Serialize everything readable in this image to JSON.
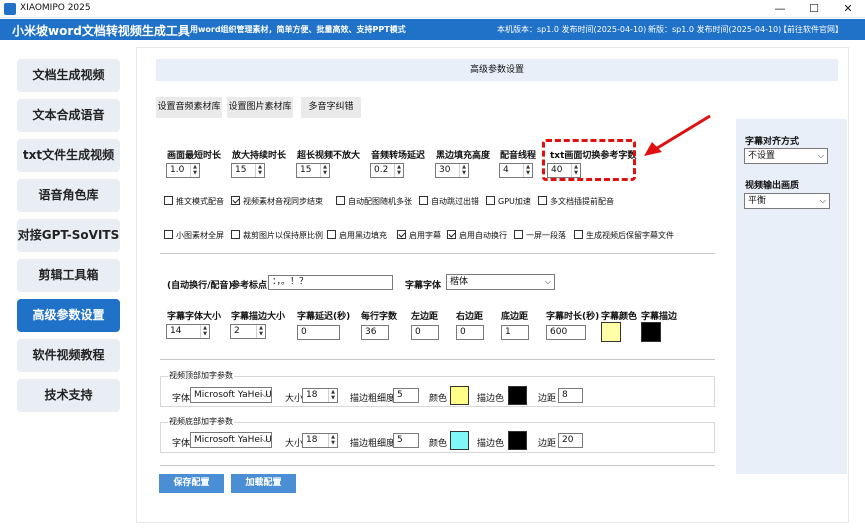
{
  "window": {
    "title": "XIAOMIPO 2025",
    "minimize": "—",
    "maximize": "☐",
    "close": "✕"
  },
  "header": {
    "brand": "小米坡word文档转视频生成工具",
    "slogan": "用word组织管理素材，简单方便、批量高效、支持PPT模式",
    "local_version": "本机版本：sp1.0  发布时间(2025-04-10)",
    "new_version": "新版：sp1.0  发布时间(2025-04-10)",
    "website_link": "【前往软件官网】"
  },
  "sidebar": {
    "items": [
      {
        "label": "文档生成视频"
      },
      {
        "label": "文本合成语音"
      },
      {
        "label": "txt文件生成视频"
      },
      {
        "label": "语音角色库"
      },
      {
        "label": "对接GPT-SoVITS"
      },
      {
        "label": "剪辑工具箱"
      },
      {
        "label": "高级参数设置",
        "active": true
      },
      {
        "label": "软件视频教程"
      },
      {
        "label": "技术支持"
      }
    ]
  },
  "panel": {
    "title": "高级参数设置"
  },
  "tabs": [
    {
      "label": "设置音频素材库"
    },
    {
      "label": "设置图片素材库"
    },
    {
      "label": "多音字纠错"
    }
  ],
  "params": [
    {
      "label": "画面最短时长",
      "value": "1.0"
    },
    {
      "label": "放大持续时长",
      "value": "15"
    },
    {
      "label": "超长视频不放大",
      "value": "15"
    },
    {
      "label": "音频转场延迟",
      "value": "0.2"
    },
    {
      "label": "黑边填充高度",
      "value": "30"
    },
    {
      "label": "配音线程",
      "value": "4"
    },
    {
      "label": "txt画面切换参考字数",
      "value": "40"
    }
  ],
  "checkboxes_row1": [
    {
      "label": "推文模式配音",
      "checked": false
    },
    {
      "label": "视频素材音视同步结束",
      "checked": true
    },
    {
      "label": "自动配图随机多张",
      "checked": false
    },
    {
      "label": "自动跳过出错",
      "checked": false
    },
    {
      "label": "GPU加速",
      "checked": false
    },
    {
      "label": "多文档插提前配音",
      "checked": false
    }
  ],
  "checkboxes_row2": [
    {
      "label": "小图素材全屏",
      "checked": false
    },
    {
      "label": "裁剪图片以保持原比例",
      "checked": false
    },
    {
      "label": "启用黑边填充",
      "checked": false
    },
    {
      "label": "启用字幕",
      "checked": true
    },
    {
      "label": "启用自动换行",
      "checked": true
    },
    {
      "label": "一屏一段落",
      "checked": false
    },
    {
      "label": "生成视频后保留字幕文件",
      "checked": false
    }
  ],
  "subtitle": {
    "autowrap_label": "(自动换行/配音)",
    "punct_label": "参考标点",
    "punct_value": "：，。！？",
    "font_label": "字幕字体",
    "font_value": "楷体",
    "fields": [
      {
        "label": "字幕字体大小",
        "value": "14"
      },
      {
        "label": "字幕描边大小",
        "value": "2"
      },
      {
        "label": "字幕延迟(秒)",
        "value": "0"
      },
      {
        "label": "每行字数",
        "value": "36"
      },
      {
        "label": "左边距",
        "value": "0"
      },
      {
        "label": "右边距",
        "value": "0"
      },
      {
        "label": "底边距",
        "value": "1"
      },
      {
        "label": "字幕时长(秒)",
        "value": "600"
      }
    ],
    "color_label": "字幕颜色",
    "stroke_label": "字幕描边",
    "color": "#ffffa8",
    "stroke_color": "#000000"
  },
  "top_text": {
    "group_title": "视频顶部加字参数",
    "font_label": "字体",
    "font_value": "Microsoft YaHei U",
    "size_label": "大小",
    "size_value": "18",
    "stroke_w_label": "描边粗细度",
    "stroke_w_value": "5",
    "color_label": "颜色",
    "color": "#ffff88",
    "stroke_label": "描边色",
    "stroke_color": "#000000",
    "margin_label": "边距",
    "margin_value": "8"
  },
  "bottom_text": {
    "group_title": "视频底部加字参数",
    "font_label": "字体",
    "font_value": "Microsoft YaHei U",
    "size_label": "大小",
    "size_value": "18",
    "stroke_w_label": "描边粗细度",
    "stroke_w_value": "5",
    "color_label": "颜色",
    "color": "#7ff7f7",
    "stroke_label": "描边色",
    "stroke_color": "#000000",
    "margin_label": "边距",
    "margin_value": "20"
  },
  "actions": {
    "save": "保存配置",
    "load": "加载配置"
  },
  "right": {
    "align_label": "字幕对齐方式",
    "align_value": "不设置",
    "quality_label": "视频输出画质",
    "quality_value": "平衡"
  }
}
